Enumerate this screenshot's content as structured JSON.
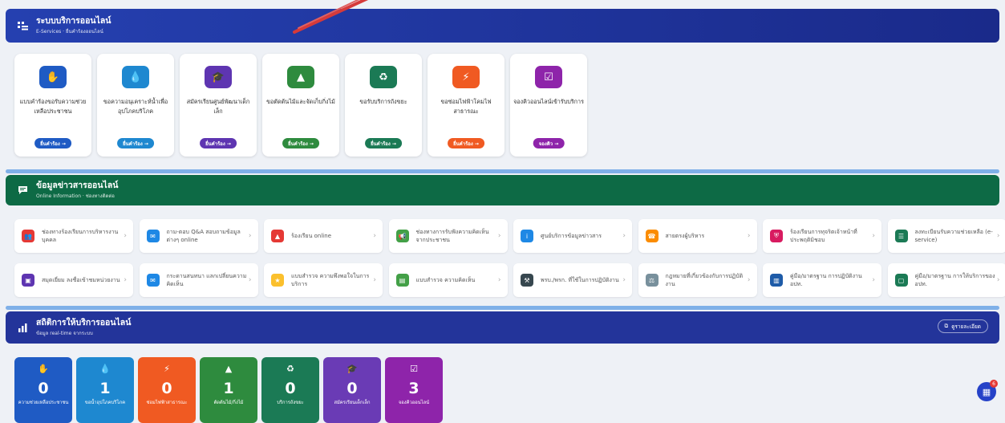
{
  "eservices": {
    "title": "ระบบบริการออนไลน์",
    "subtitle": "E-Services · ยื่นคำร้องออนไลน์",
    "cards": [
      {
        "icon": "hand-heart-icon",
        "label": "แบบคำร้องขอรับความช่วยเหลือประชาชน",
        "button": "ยื่นคำร้อง →",
        "color": "#1f5bc4"
      },
      {
        "icon": "water-drop-icon",
        "label": "ขอความอนุเคราะห์น้ำเพื่ออุปโภคบริโภค",
        "button": "ยื่นคำร้อง →",
        "color": "#1e88d0"
      },
      {
        "icon": "graduation-cap-icon",
        "label": "สมัครเรียนศูนย์พัฒนาเด็กเล็ก",
        "button": "ยื่นคำร้อง →",
        "color": "#5e35b1"
      },
      {
        "icon": "tree-icon",
        "label": "ขอตัดต้นไม้และจัดเก็บกิ่งไม้",
        "button": "ยื่นคำร้อง →",
        "color": "#2e8b3e"
      },
      {
        "icon": "recycle-icon",
        "label": "ขอรับบริการถังขยะ",
        "button": "ยื่นคำร้อง →",
        "color": "#1b7a55"
      },
      {
        "icon": "lightning-icon",
        "label": "ขอซ่อมไฟฟ้าโคมไฟสาธารณะ",
        "button": "ยื่นคำร้อง →",
        "color": "#f05a22"
      },
      {
        "icon": "calendar-check-icon",
        "label": "จองคิวออนไลน์เข้ารับบริการ",
        "button": "จองคิว →",
        "color": "#8e24aa"
      }
    ]
  },
  "info": {
    "title": "ข้อมูลข่าวสารออนไลน์",
    "subtitle": "Online Information · ช่องทางติดต่อ",
    "items": [
      {
        "icon": "people-icon",
        "label": "ช่องทางร้องเรียนการบริหารงานบุคคล",
        "color": "#e53935"
      },
      {
        "icon": "chat-icon",
        "label": "ถาม-ตอบ Q&A สอบถามข้อมูลต่างๆ online",
        "color": "#1e88e5"
      },
      {
        "icon": "warning-icon",
        "label": "ร้องเรียน online",
        "color": "#e53935"
      },
      {
        "icon": "megaphone-icon",
        "label": "ช่องทางการรับฟังความคิดเห็นจากประชาชน",
        "color": "#43a047"
      },
      {
        "icon": "info-icon",
        "label": "ศูนย์บริการข้อมูลข่าวสาร",
        "color": "#1e88e5"
      },
      {
        "icon": "hotline-icon",
        "label": "สายตรงผู้บริหาร",
        "color": "#fb8c00"
      },
      {
        "icon": "shield-icon",
        "label": "ร้องเรียนการทุจริตเจ้าหน้าที่ประพฤติมิชอบ",
        "color": "#d81b60"
      },
      {
        "icon": "list-icon",
        "label": "ลงทะเบียนรับความช่วยเหลือ (e-service)",
        "color": "#1b7a55"
      },
      {
        "icon": "guestbook-icon",
        "label": "สมุดเยี่ยม ลงชื่อเข้าชมหน่วยงาน",
        "color": "#5e35b1"
      },
      {
        "icon": "forum-icon",
        "label": "กระดานสนทนา แลกเปลี่ยนความคิดเห็น",
        "color": "#1e88e5"
      },
      {
        "icon": "star-icon",
        "label": "แบบสำรวจ ความพึงพอใจในการบริการ",
        "color": "#fbc02d"
      },
      {
        "icon": "survey-icon",
        "label": "แบบสำรวจ ความคิดเห็น",
        "color": "#43a047"
      },
      {
        "icon": "gavel-icon",
        "label": "พรบ./พรก. ที่ใช้ในการปฏิบัติงาน",
        "color": "#37474f"
      },
      {
        "icon": "law-icon",
        "label": "กฎหมายที่เกี่ยวข้องกับการปฏิบัติงาน",
        "color": "#78909c"
      },
      {
        "icon": "manual-icon",
        "label": "คู่มือ/มาตรฐาน การปฏิบัติงาน อปท.",
        "color": "#1e5ba8"
      },
      {
        "icon": "document-icon",
        "label": "คู่มือ/มาตรฐาน การให้บริการของ อปท.",
        "color": "#1b7a55"
      }
    ]
  },
  "stats": {
    "title": "สถิติการให้บริการออนไลน์",
    "subtitle": "ข้อมูล real-time จากระบบ",
    "detail_button": "ดูรายละเอียด",
    "tiles": [
      {
        "icon": "hand-heart-icon",
        "value": "0",
        "label": "ความช่วยเหลือประชาชน",
        "color": "#1f5bc4"
      },
      {
        "icon": "water-drop-icon",
        "value": "1",
        "label": "ขอน้ำอุปโภคบริโภค",
        "color": "#1e88d0"
      },
      {
        "icon": "lightning-icon",
        "value": "0",
        "label": "ซ่อมไฟฟ้าสาธารณะ",
        "color": "#f05a22"
      },
      {
        "icon": "tree-icon",
        "value": "1",
        "label": "ตัดต้นไม้/กิ่งไม้",
        "color": "#2e8b3e"
      },
      {
        "icon": "recycle-icon",
        "value": "0",
        "label": "บริการถังขยะ",
        "color": "#1b7a55"
      },
      {
        "icon": "graduation-cap-icon",
        "value": "0",
        "label": "สมัครเรียนเด็กเล็ก",
        "color": "#6a3bb5"
      },
      {
        "icon": "calendar-check-icon",
        "value": "3",
        "label": "จองคิวออนไลน์",
        "color": "#8e24aa"
      }
    ]
  },
  "fab": {
    "icon": "grid-icon",
    "badge": "6"
  }
}
